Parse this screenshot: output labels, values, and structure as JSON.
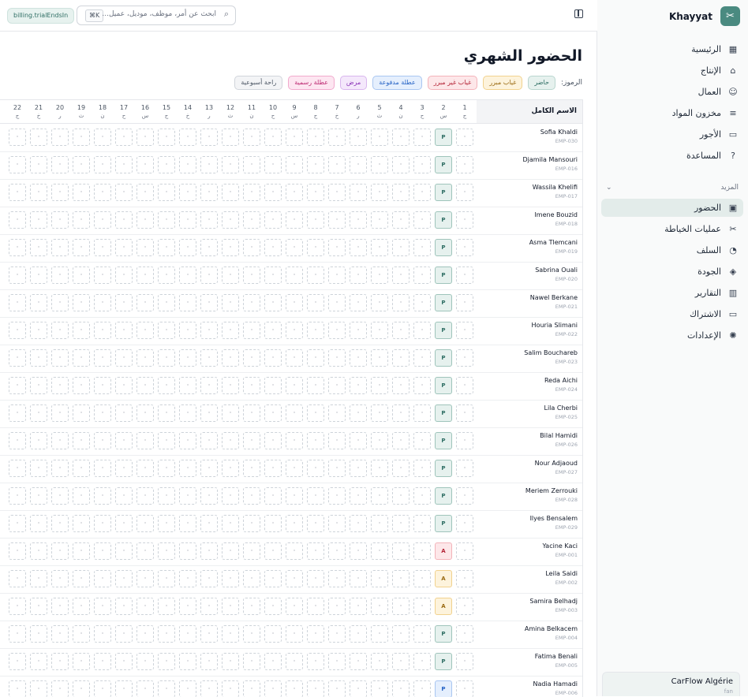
{
  "app": {
    "name": "Khayyat",
    "trial_badge": "billing.trialEndsIn"
  },
  "search": {
    "placeholder": "ابحث عن أمر، موظف، موديل، عميل...",
    "shortcut": "⌘K"
  },
  "sidebar": {
    "primary": [
      {
        "label": "الرئيسية",
        "icon": "grid-icon",
        "glyph": "▦"
      },
      {
        "label": "الإنتاج",
        "icon": "factory-icon",
        "glyph": "⌂"
      },
      {
        "label": "العمال",
        "icon": "users-icon",
        "glyph": "☺"
      },
      {
        "label": "مخزون المواد",
        "icon": "database-icon",
        "glyph": "≡"
      },
      {
        "label": "الأجور",
        "icon": "wallet-icon",
        "glyph": "▭"
      },
      {
        "label": "المساعدة",
        "icon": "help-icon",
        "glyph": "?"
      }
    ],
    "more_label": "المزيد",
    "secondary": [
      {
        "label": "الحضور",
        "icon": "calendar-icon",
        "glyph": "▣",
        "active": true
      },
      {
        "label": "عمليات الخياطة",
        "icon": "scissors-icon",
        "glyph": "✂"
      },
      {
        "label": "السلف",
        "icon": "hand-coins-icon",
        "glyph": "◔"
      },
      {
        "label": "الجودة",
        "icon": "shield-check-icon",
        "glyph": "◈"
      },
      {
        "label": "التقارير",
        "icon": "bar-chart-icon",
        "glyph": "▥"
      },
      {
        "label": "الاشتراك",
        "icon": "credit-card-icon",
        "glyph": "▭"
      },
      {
        "label": "الإعدادات",
        "icon": "gear-icon",
        "glyph": "✺"
      }
    ],
    "org": {
      "name": "CarFlow Algérie",
      "sub": "fan"
    }
  },
  "page": {
    "title": "الحضور الشهري",
    "legend_label": "الرموز:",
    "legend": [
      {
        "label": "حاضر",
        "bg": "#e6f1ee",
        "border": "#b9d6cf",
        "color": "#2f6e64"
      },
      {
        "label": "غياب مبرر",
        "bg": "#fdf3dc",
        "border": "#f1d28e",
        "color": "#9a6a12"
      },
      {
        "label": "غياب غير مبرر",
        "bg": "#fde7e9",
        "border": "#f3b3ba",
        "color": "#b42336"
      },
      {
        "label": "عطلة مدفوعة",
        "bg": "#e5effd",
        "border": "#a9c6f1",
        "color": "#2563c5"
      },
      {
        "label": "مرض",
        "bg": "#f4e8fb",
        "border": "#d9b6ee",
        "color": "#8b33b8"
      },
      {
        "label": "عطلة رسمية",
        "bg": "#fde6f1",
        "border": "#f1aacd",
        "color": "#be2b73"
      },
      {
        "label": "راحة أسبوعية",
        "bg": "#f3f4f6",
        "border": "#d1d5db",
        "color": "#4b5563"
      }
    ]
  },
  "table": {
    "name_header": "الاسم الكامل",
    "days": [
      {
        "d": "1",
        "w": "ج"
      },
      {
        "d": "2",
        "w": "س"
      },
      {
        "d": "3",
        "w": "ح"
      },
      {
        "d": "4",
        "w": "ن"
      },
      {
        "d": "5",
        "w": "ث"
      },
      {
        "d": "6",
        "w": "ر"
      },
      {
        "d": "7",
        "w": "خ"
      },
      {
        "d": "8",
        "w": "ج"
      },
      {
        "d": "9",
        "w": "س"
      },
      {
        "d": "10",
        "w": "ح"
      },
      {
        "d": "11",
        "w": "ن"
      },
      {
        "d": "12",
        "w": "ث"
      },
      {
        "d": "13",
        "w": "ر"
      },
      {
        "d": "14",
        "w": "خ"
      },
      {
        "d": "15",
        "w": "ج"
      },
      {
        "d": "16",
        "w": "س"
      },
      {
        "d": "17",
        "w": "ح"
      },
      {
        "d": "18",
        "w": "ن"
      },
      {
        "d": "19",
        "w": "ث"
      },
      {
        "d": "20",
        "w": "ر"
      },
      {
        "d": "21",
        "w": "خ"
      },
      {
        "d": "22",
        "w": "ج"
      }
    ],
    "rows": [
      {
        "name": "Sofia Khaldi",
        "id": "EMP-030",
        "status": "P"
      },
      {
        "name": "Djamila Mansouri",
        "id": "EMP-016",
        "status": "P"
      },
      {
        "name": "Wassila Khelifi",
        "id": "EMP-017",
        "status": "P"
      },
      {
        "name": "Imene Bouzid",
        "id": "EMP-018",
        "status": "P"
      },
      {
        "name": "Asma Tlemcani",
        "id": "EMP-019",
        "status": "P"
      },
      {
        "name": "Sabrina Ouali",
        "id": "EMP-020",
        "status": "P"
      },
      {
        "name": "Nawel Berkane",
        "id": "EMP-021",
        "status": "P"
      },
      {
        "name": "Houria Slimani",
        "id": "EMP-022",
        "status": "P"
      },
      {
        "name": "Salim Bouchareb",
        "id": "EMP-023",
        "status": "P"
      },
      {
        "name": "Reda Aichi",
        "id": "EMP-024",
        "status": "P"
      },
      {
        "name": "Lila Cherbi",
        "id": "EMP-025",
        "status": "P"
      },
      {
        "name": "Bilal Hamidi",
        "id": "EMP-026",
        "status": "P"
      },
      {
        "name": "Nour Adjaoud",
        "id": "EMP-027",
        "status": "P"
      },
      {
        "name": "Meriem Zerrouki",
        "id": "EMP-028",
        "status": "P"
      },
      {
        "name": "Ilyes Bensalem",
        "id": "EMP-029",
        "status": "P"
      },
      {
        "name": "Yacine Kaci",
        "id": "EMP-001",
        "status": "A"
      },
      {
        "name": "Leila Saidi",
        "id": "EMP-002",
        "status": "J"
      },
      {
        "name": "Samira Belhadj",
        "id": "EMP-003",
        "status": "J"
      },
      {
        "name": "Amina Belkacem",
        "id": "EMP-004",
        "status": "P"
      },
      {
        "name": "Fatima Benali",
        "id": "EMP-005",
        "status": "P"
      },
      {
        "name": "Nadia Hamadi",
        "id": "EMP-006",
        "status": "V"
      }
    ],
    "empty_cell": "·",
    "status_styles": {
      "P": {
        "text": "P",
        "bg": "#e6f1ee",
        "border": "#9fc4bb",
        "color": "#2f6e64"
      },
      "A": {
        "text": "A",
        "bg": "#fde7e9",
        "border": "#f3b3ba",
        "color": "#b42336"
      },
      "J": {
        "text": "A",
        "bg": "#fdf3dc",
        "border": "#f1d28e",
        "color": "#9a6a12"
      },
      "V": {
        "text": "P",
        "bg": "#e5effd",
        "border": "#a9c6f1",
        "color": "#2563c5"
      }
    }
  }
}
